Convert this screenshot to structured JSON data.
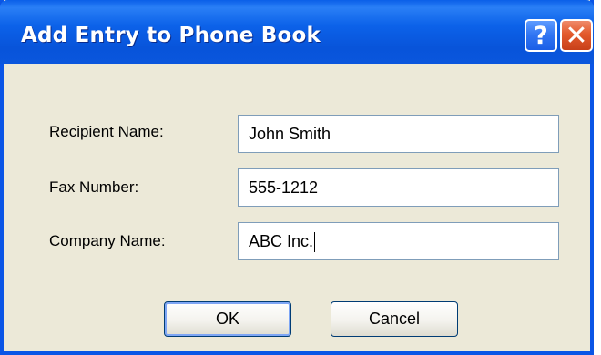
{
  "window": {
    "title": "Add Entry to Phone Book",
    "help_icon": "?",
    "close_icon": "✕"
  },
  "form": {
    "recipient_label": "Recipient Name:",
    "recipient_value": "John Smith",
    "fax_label": "Fax Number:",
    "fax_value": "555-1212",
    "company_label": "Company Name:",
    "company_value": "ABC Inc."
  },
  "buttons": {
    "ok_label": "OK",
    "cancel_label": "Cancel"
  },
  "colors": {
    "titlebar": "#0a55e6",
    "dialog_background": "#ece9d8",
    "close_button": "#e35a2c"
  }
}
